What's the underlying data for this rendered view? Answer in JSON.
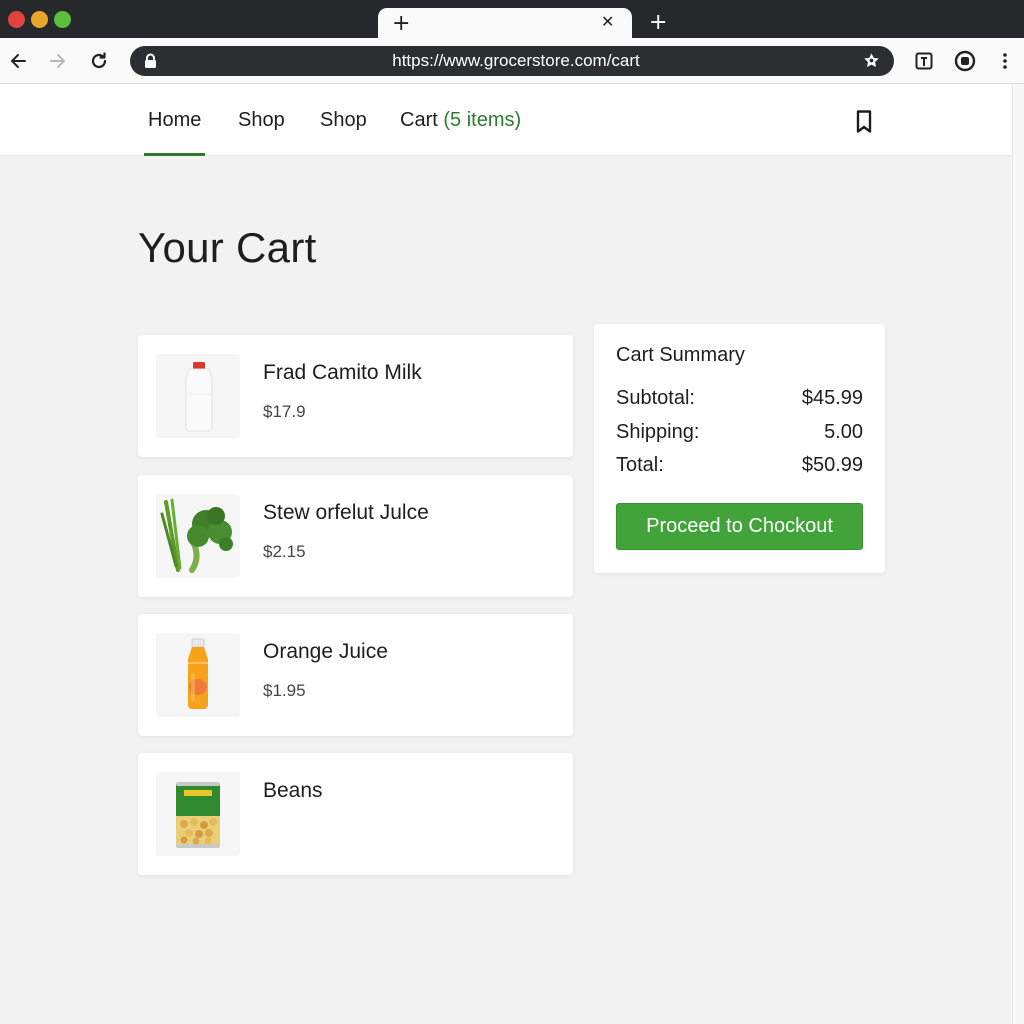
{
  "browser": {
    "tab_close_glyph": "✕",
    "tab_add_glyph": "+",
    "url": "https://www.grocerstore.com/cart",
    "colors": {
      "chrome_dark": "#26282c",
      "omnibox": "#2c2e31"
    }
  },
  "nav": {
    "items": [
      {
        "label": "Home",
        "active": true
      },
      {
        "label": "Shop"
      },
      {
        "label": "Shop"
      }
    ],
    "cart_label": "Cart",
    "cart_count": "(5 items)",
    "accent": "#2d7a2d"
  },
  "page": {
    "title": "Your Cart"
  },
  "cart": {
    "items": [
      {
        "name": "Frad Camito Milk",
        "price": "$17.9",
        "image": "milk-jug"
      },
      {
        "name": "Stew orfelut Julce",
        "price": "$2.15",
        "image": "broccoli"
      },
      {
        "name": "Orange Juice",
        "price": "$1.95",
        "image": "juice-bottle"
      },
      {
        "name": "Beans",
        "price": "",
        "image": "bean-can"
      }
    ]
  },
  "summary": {
    "title": "Cart Summary",
    "subtotal_label": "Subtotal:",
    "subtotal_value": "$45.99",
    "shipping_label": "Shipping:",
    "shipping_value": "5.00",
    "total_label": "Total:",
    "total_value": "$50.99",
    "checkout_label": "Proceed to Chockout",
    "button_color": "#41a33a"
  }
}
